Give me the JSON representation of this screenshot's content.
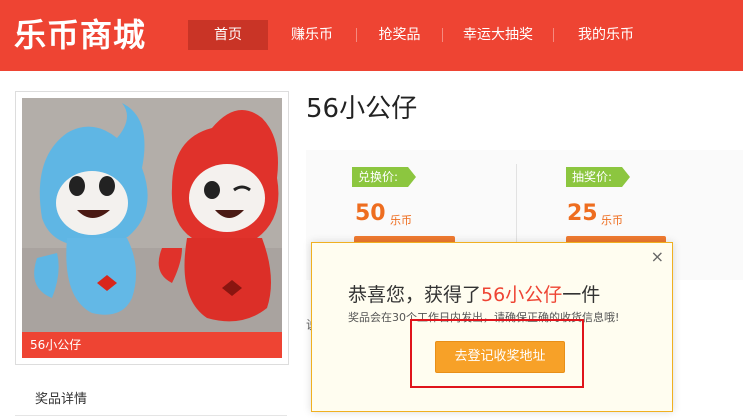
{
  "header": {
    "logo": "乐币商城",
    "nav": [
      {
        "label": "首页",
        "active": true
      },
      {
        "label": "赚乐币",
        "active": false
      },
      {
        "label": "抢奖品",
        "active": false
      },
      {
        "label": "幸运大抽奖",
        "active": false
      },
      {
        "label": "我的乐币",
        "active": false
      }
    ]
  },
  "product": {
    "image_caption": "56小公仔",
    "title": "56小公仔",
    "detail_tab": "奖品详情",
    "exchange": {
      "tag": "兑换价:",
      "price": "50",
      "unit": "乐币"
    },
    "lottery": {
      "tag": "抽奖价:",
      "price": "25",
      "unit": "乐币"
    },
    "hint_char": "说"
  },
  "modal": {
    "close": "×",
    "title_prefix": "恭喜您，获得了",
    "title_highlight": "56小公仔",
    "title_suffix": "一件",
    "subtitle": "奖品会在30个工作日内发出，请确保正确的收货信息哦!",
    "button": "去登记收奖地址"
  },
  "colors": {
    "brand": "#ee4433",
    "price": "#ee6d1f",
    "tag": "#8cc63f",
    "modal_button": "#f7a128",
    "annotation": "#e0141b"
  }
}
